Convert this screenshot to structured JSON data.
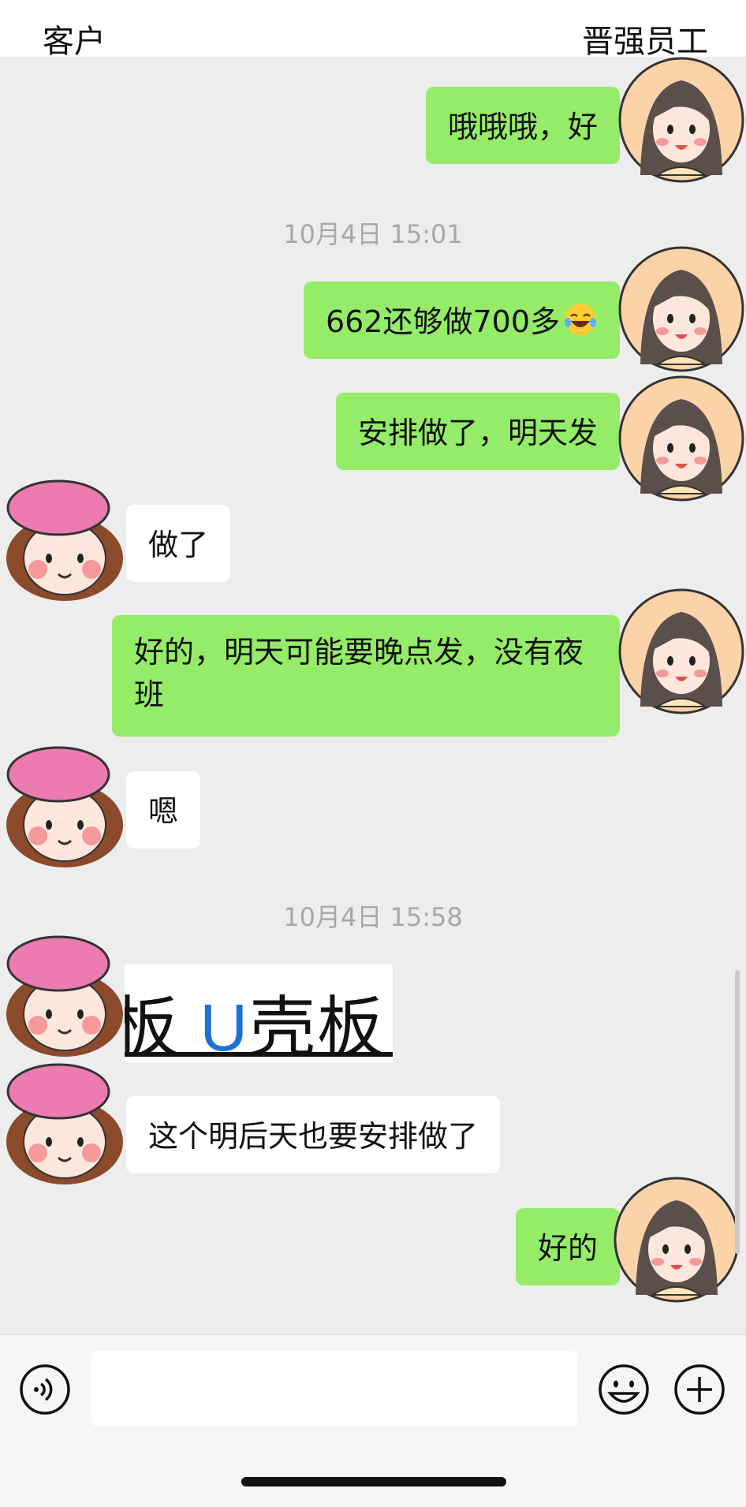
{
  "header": {
    "left_title": "客户",
    "right_title": "晋强员工"
  },
  "messages": [
    {
      "text": "哦哦哦，好"
    },
    {
      "timestamp": "10月4日 15:01"
    },
    {
      "text": "662还够做700多",
      "emoji": "laughing-crying-emoji"
    },
    {
      "text": "安排做了，明天发"
    },
    {
      "text": "做了"
    },
    {
      "text": "好的，明天可能要晚点发，没有夜班"
    },
    {
      "text": "嗯"
    },
    {
      "timestamp": "10月4日 15:58"
    },
    {
      "image_text": [
        "板",
        "U",
        "壳板"
      ]
    },
    {
      "text": "这个明后天也要安排做了"
    },
    {
      "text": "好的"
    }
  ],
  "avatars": {
    "customer": "customer-avatar",
    "staff": "staff-avatar"
  },
  "colors": {
    "outgoing_bubble": "#95ec69",
    "incoming_bubble": "#ffffff",
    "background": "#ededed"
  },
  "input": {
    "value": ""
  },
  "icons": [
    "voice-icon",
    "emoji-icon",
    "plus-icon"
  ]
}
